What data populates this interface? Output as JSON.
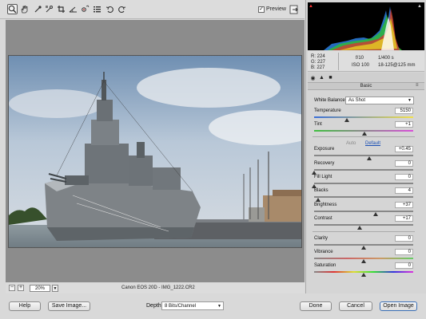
{
  "toolbar": {
    "tools": [
      {
        "name": "zoom-tool",
        "icon": "magnifier-icon"
      },
      {
        "name": "hand-tool",
        "icon": "hand-icon"
      },
      {
        "name": "white-balance-tool",
        "icon": "eyedropper-icon"
      },
      {
        "name": "color-sampler-tool",
        "icon": "color-sampler-icon"
      },
      {
        "name": "crop-tool",
        "icon": "crop-icon"
      },
      {
        "name": "straighten-tool",
        "icon": "straighten-icon"
      },
      {
        "name": "red-eye-tool",
        "icon": "red-eye-icon"
      },
      {
        "name": "preferences-tool",
        "icon": "list-icon"
      },
      {
        "name": "rotate-ccw-tool",
        "icon": "rotate-ccw-icon"
      },
      {
        "name": "rotate-cw-tool",
        "icon": "rotate-cw-icon"
      }
    ],
    "preview_label": "Preview",
    "preview_checked": true
  },
  "status": {
    "zoom_value": "20%",
    "camera_info": "Canon EOS 20D  -  IMG_1222.CR2"
  },
  "readout": {
    "r": "R:  224",
    "g": "G:  227",
    "b": "B:  227",
    "aperture": "f/10",
    "shutter": "1/400 s",
    "iso": "ISO 100",
    "lens": "18-125@125 mm"
  },
  "panel": {
    "title": "Basic",
    "white_balance_label": "White Balance:",
    "white_balance_value": "As Shot",
    "auto_label": "Auto",
    "default_label": "Default",
    "sliders": [
      {
        "key": "temperature",
        "label": "Temperature",
        "value": "5150",
        "position": 0.33
      },
      {
        "key": "tint",
        "label": "Tint",
        "value": "+1",
        "position": 0.51
      },
      {
        "key": "exposure",
        "label": "Exposure",
        "value": "+0.45",
        "position": 0.56
      },
      {
        "key": "recovery",
        "label": "Recovery",
        "value": "0",
        "position": 0.0
      },
      {
        "key": "fill-light",
        "label": "Fill Light",
        "value": "0",
        "position": 0.0
      },
      {
        "key": "blacks",
        "label": "Blacks",
        "value": "4",
        "position": 0.04
      },
      {
        "key": "brightness",
        "label": "Brightness",
        "value": "+37",
        "position": 0.62
      },
      {
        "key": "contrast",
        "label": "Contrast",
        "value": "+17",
        "position": 0.46
      },
      {
        "key": "clarity",
        "label": "Clarity",
        "value": "0",
        "position": 0.5
      },
      {
        "key": "vibrance",
        "label": "Vibrance",
        "value": "0",
        "position": 0.5
      },
      {
        "key": "saturation",
        "label": "Saturation",
        "value": "0",
        "position": 0.5
      }
    ]
  },
  "footer": {
    "help_label": "Help",
    "save_label": "Save Image...",
    "depth_label": "Depth:",
    "depth_value": "8 Bits/Channel",
    "done_label": "Done",
    "cancel_label": "Cancel",
    "open_label": "Open Image"
  },
  "colors": {
    "canvas_bg": "#8c8c8c",
    "accent": "#3b6fb6"
  }
}
